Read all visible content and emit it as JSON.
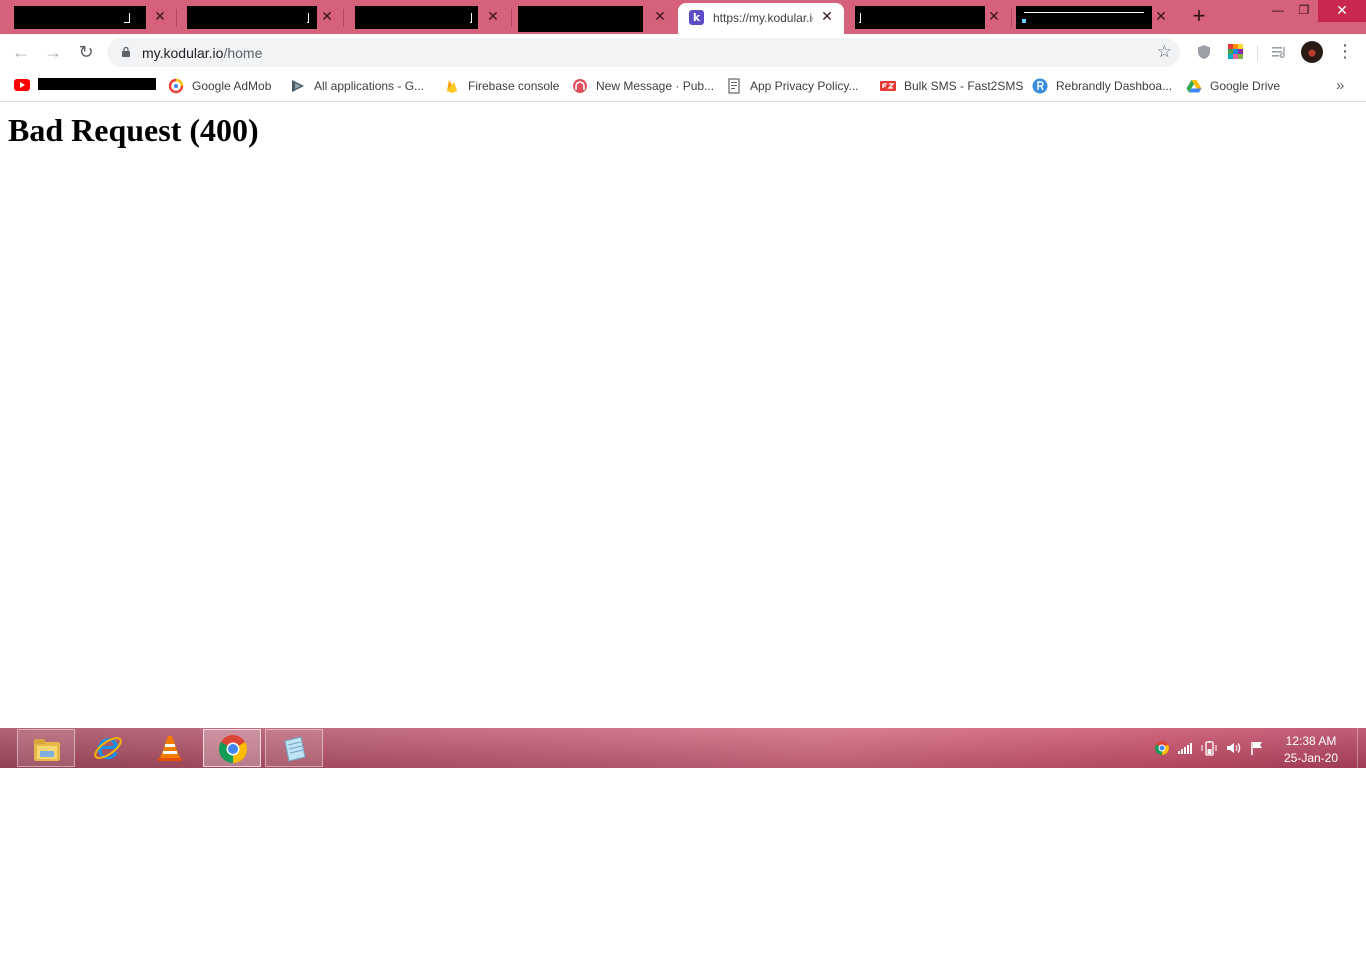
{
  "browser": {
    "tabs": [
      {
        "redacted": true
      },
      {
        "redacted": true
      },
      {
        "redacted": true
      },
      {
        "redacted": true
      },
      {
        "title": "https://my.kodular.io/home",
        "active": true,
        "favicon": "kodular-k-icon",
        "favicon_letter": "k"
      },
      {
        "redacted": true
      },
      {
        "redacted": true
      }
    ],
    "close_glyph": "✕",
    "new_tab_glyph": "+",
    "window_controls": {
      "minimize": "—",
      "restore": "❐",
      "close": "✕"
    },
    "toolbar": {
      "back_glyph": "←",
      "forward_glyph": "→",
      "reload_glyph": "↻",
      "url_host": "my.kodular.io",
      "url_path": "/home",
      "star_glyph": "☆",
      "menu_glyph": "⋮"
    },
    "bookmarks": [
      {
        "label": "Google AdMob",
        "icon": "admob-icon"
      },
      {
        "label": "All applications - G...",
        "icon": "play-console-icon"
      },
      {
        "label": "Firebase console",
        "icon": "firebase-icon"
      },
      {
        "label": "New Message · Pub...",
        "icon": "pubnub-icon"
      },
      {
        "label": "App Privacy Policy...",
        "icon": "document-icon"
      },
      {
        "label": "Bulk SMS - Fast2SMS",
        "icon": "fast2sms-icon"
      },
      {
        "label": "Rebrandly Dashboa...",
        "icon": "rebrandly-icon"
      },
      {
        "label": "Google Drive",
        "icon": "google-drive-icon"
      }
    ],
    "bookmarks_overflow_glyph": "»"
  },
  "page": {
    "heading": "Bad Request (400)"
  },
  "taskbar": {
    "apps": [
      {
        "name": "file-explorer-icon",
        "running": false
      },
      {
        "name": "internet-explorer-icon",
        "running": false
      },
      {
        "name": "vlc-icon",
        "running": false
      },
      {
        "name": "chrome-icon",
        "running": true
      },
      {
        "name": "notepad-icon",
        "running": false
      }
    ],
    "clock_time": "12:38 AM",
    "clock_date": "25-Jan-20"
  },
  "colors": {
    "tabstrip": "#d5617a",
    "accent_close": "#c8284b",
    "kodular": "#5b4bc4"
  }
}
